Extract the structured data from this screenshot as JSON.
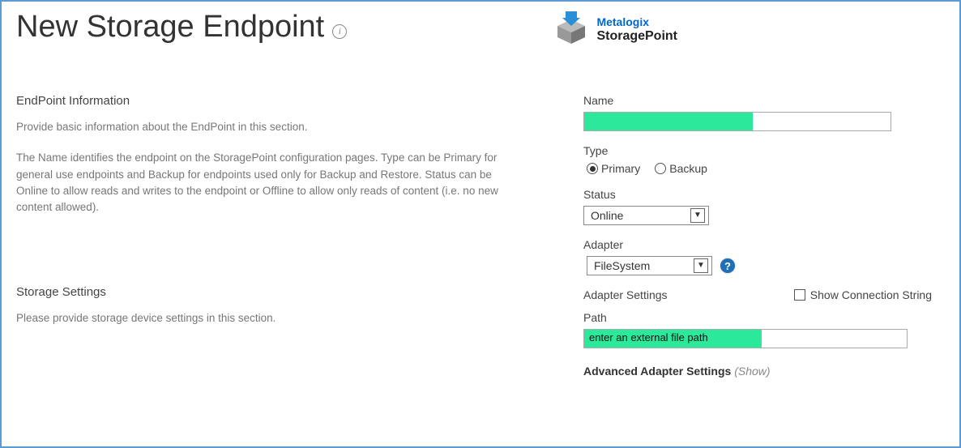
{
  "header": {
    "title": "New Storage Endpoint",
    "brand": "Metalogix",
    "product": "StoragePoint"
  },
  "left": {
    "endpoint_info_heading": "EndPoint Information",
    "endpoint_info_intro": "Provide basic information about the EndPoint in this section.",
    "endpoint_info_desc": "The Name identifies the endpoint on the StoragePoint configuration pages. Type can be Primary for general use endpoints and Backup for endpoints used only for Backup and Restore. Status can be Online to allow reads and writes to the endpoint or Offline to allow only reads of content (i.e. no new content allowed).",
    "storage_settings_heading": "Storage Settings",
    "storage_settings_desc": "Please provide storage device settings in this section."
  },
  "form": {
    "name_label": "Name",
    "name_value": "",
    "type_label": "Type",
    "type_primary": "Primary",
    "type_backup": "Backup",
    "status_label": "Status",
    "status_value": "Online",
    "adapter_label": "Adapter",
    "adapter_value": "FileSystem",
    "adapter_settings_label": "Adapter Settings",
    "show_conn_label": "Show Connection String",
    "path_label": "Path",
    "path_value": "enter an external file path",
    "advanced_label": "Advanced Adapter Settings",
    "show_text": "(Show)"
  }
}
